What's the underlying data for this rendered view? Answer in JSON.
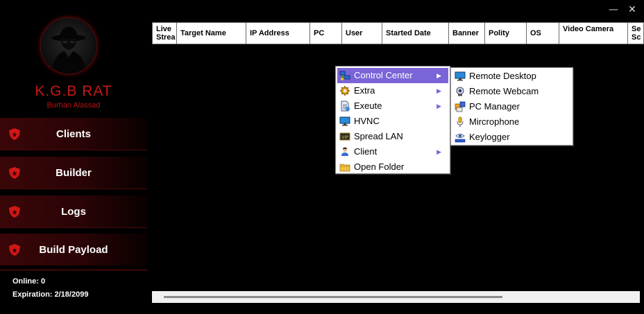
{
  "window": {
    "minimize_glyph": "—",
    "close_glyph": "✕"
  },
  "sidebar": {
    "brand": "K.G.B RAT",
    "author": "Burhan Alassad",
    "items": [
      {
        "label": "Clients",
        "icon": "shield-icon"
      },
      {
        "label": "Builder",
        "icon": "shield-icon"
      },
      {
        "label": "Logs",
        "icon": "shield-icon"
      },
      {
        "label": "Build Payload",
        "icon": "shield-icon"
      }
    ],
    "online": "Online: 0",
    "expiration": "Expiration: 2/18/2099"
  },
  "grid": {
    "columns": [
      "Live Strea",
      "Target Name",
      "IP Address",
      "PC",
      "User",
      "Started Date",
      "Banner",
      "Polity",
      "OS",
      "Video Camera",
      "Se Sc"
    ]
  },
  "context_menu": {
    "items": [
      {
        "label": "Control Center",
        "icon": "network-icon",
        "submenu": true,
        "active": true
      },
      {
        "label": "Extra",
        "icon": "gear-icon",
        "submenu": true
      },
      {
        "label": "Exeute",
        "icon": "document-icon",
        "submenu": true
      },
      {
        "label": "HVNC",
        "icon": "monitor-icon",
        "submenu": false
      },
      {
        "label": "Spread LAN",
        "icon": "vip-icon",
        "submenu": false
      },
      {
        "label": "Client",
        "icon": "user-icon",
        "submenu": true
      },
      {
        "label": "Open Folder",
        "icon": "folder-icon",
        "submenu": false
      }
    ],
    "arrow_glyph": "▶"
  },
  "submenu": {
    "items": [
      {
        "label": "Remote Desktop",
        "icon": "monitor-icon"
      },
      {
        "label": "Remote Webcam",
        "icon": "webcam-icon"
      },
      {
        "label": "PC Manager",
        "icon": "pc-manager-icon"
      },
      {
        "label": "Mircrophone",
        "icon": "microphone-icon"
      },
      {
        "label": "Keylogger",
        "icon": "keylogger-icon"
      }
    ]
  },
  "colors": {
    "accent": "#7b64d8",
    "brand_red": "#c81818",
    "nav_bg": "#3a0608"
  }
}
